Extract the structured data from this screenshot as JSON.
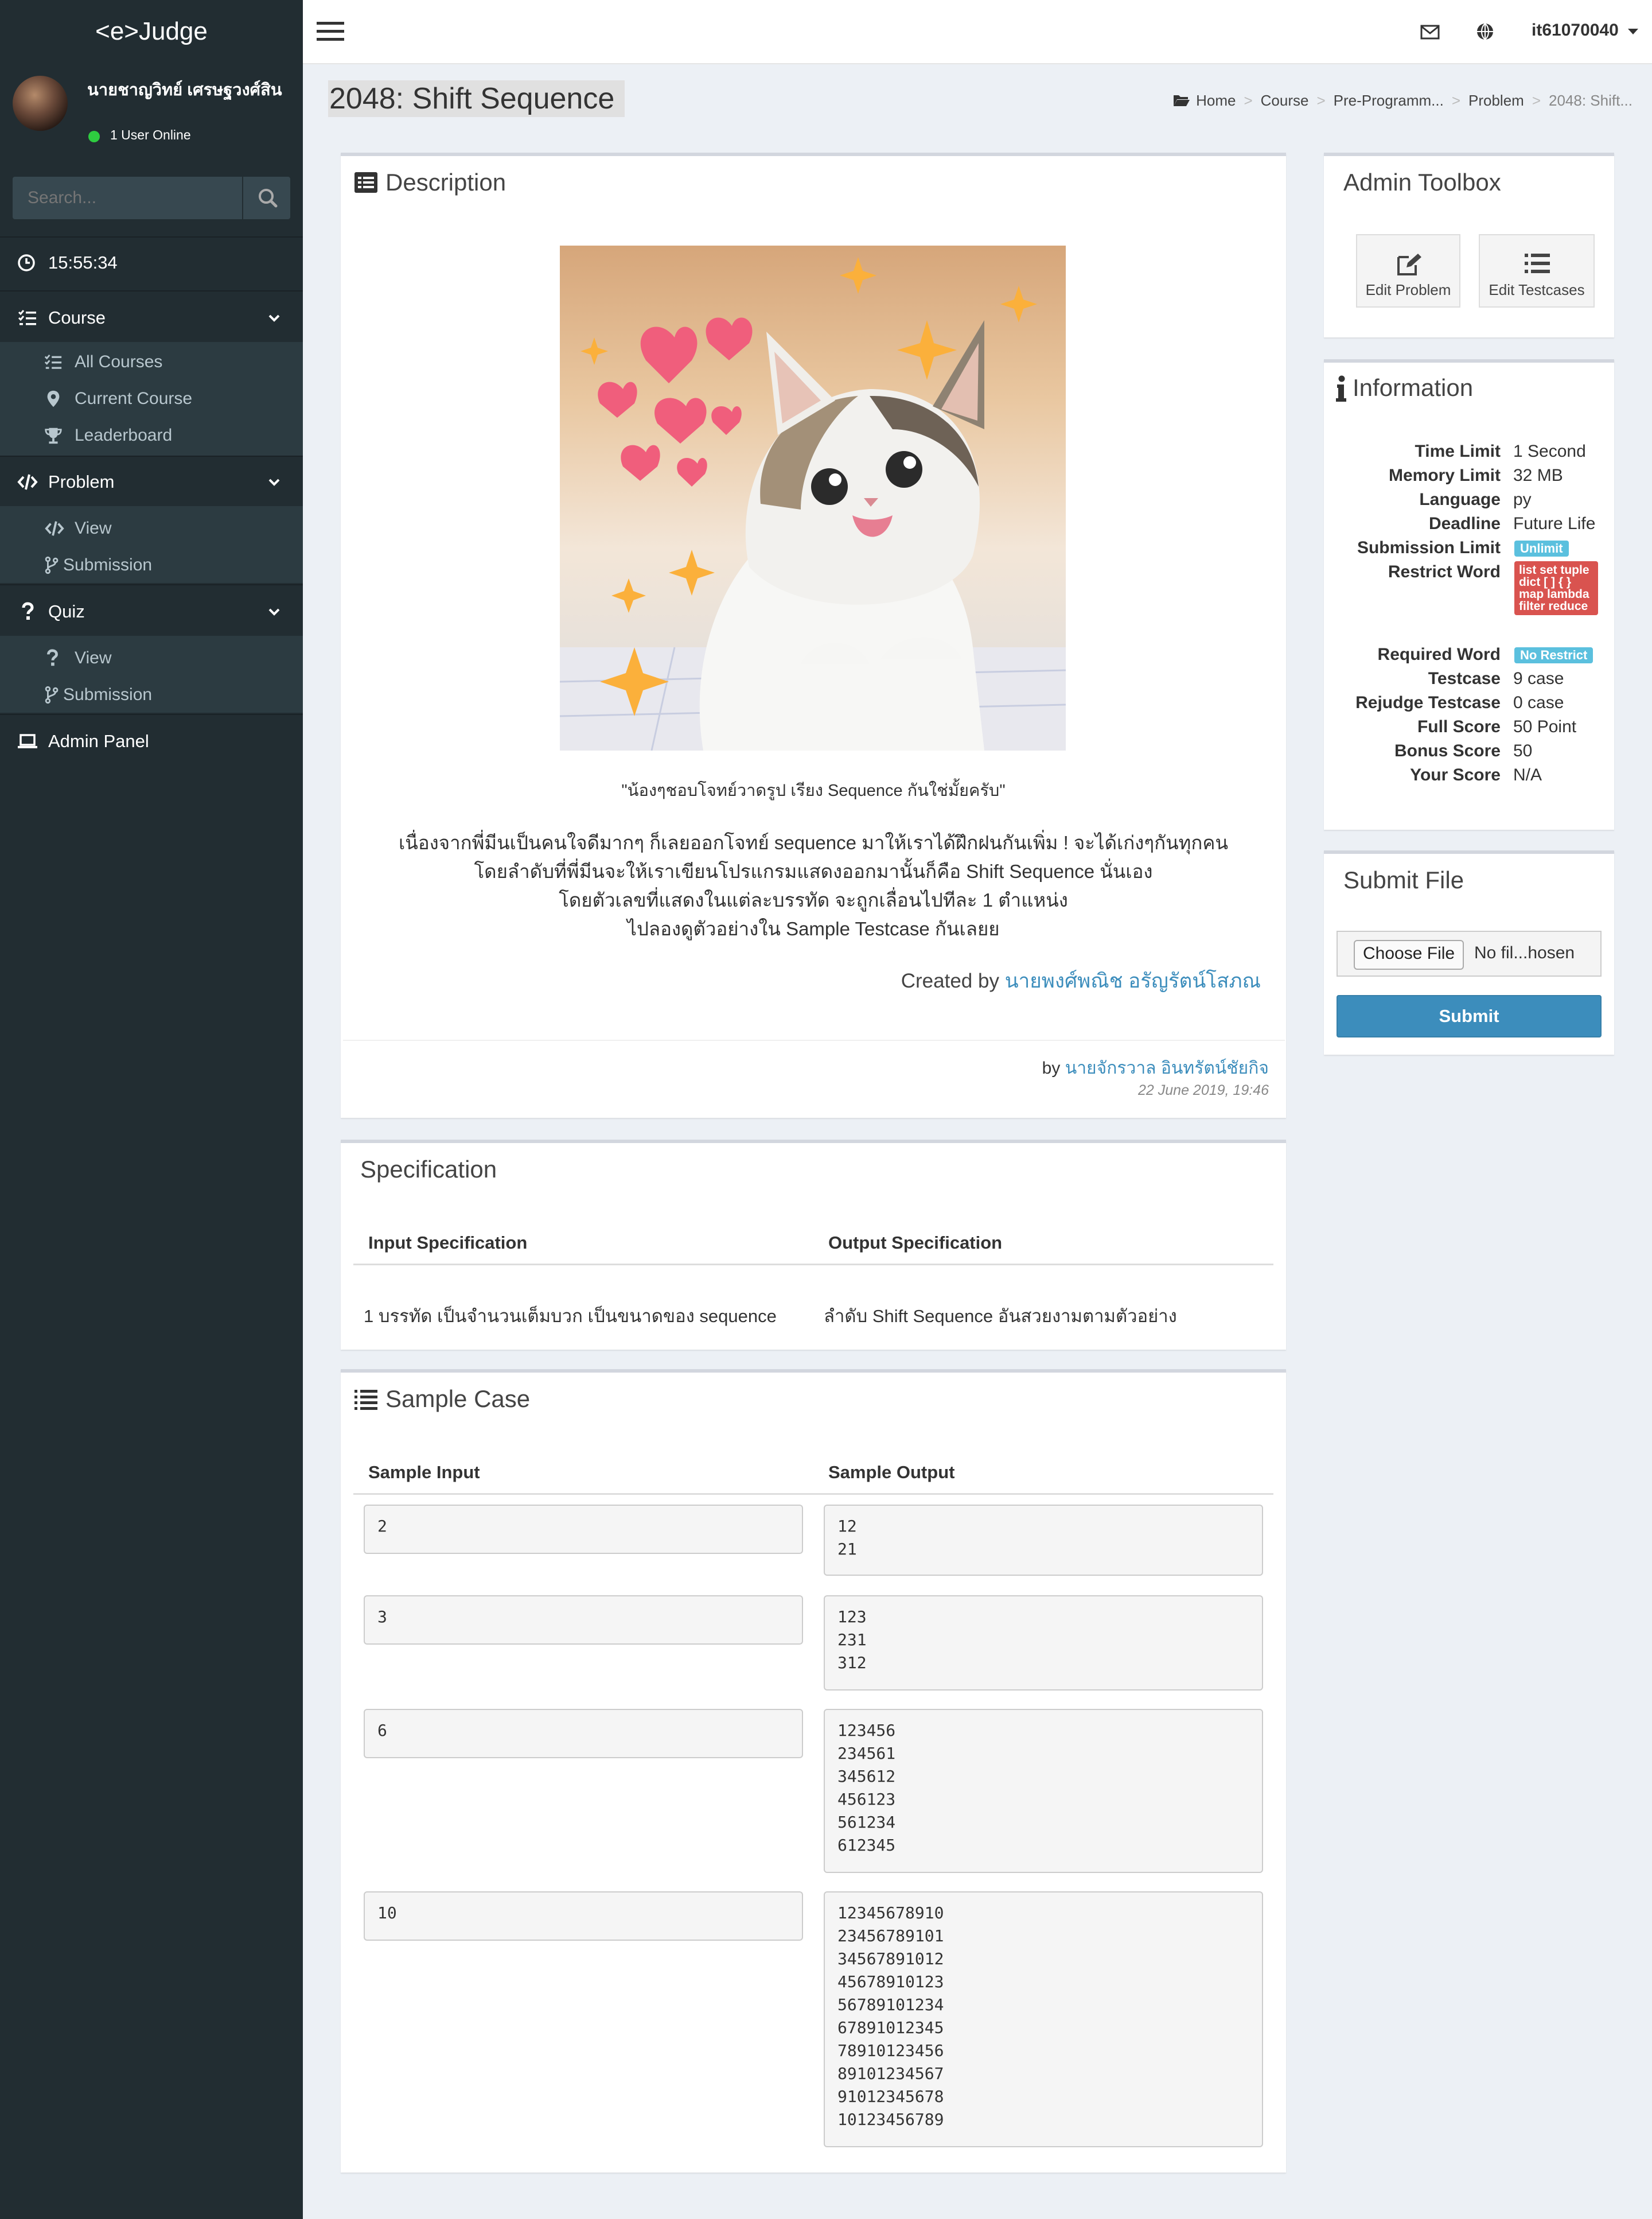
{
  "app": {
    "brand": "<e>Judge"
  },
  "user_panel": {
    "name": "นายชาญวิทย์ เศรษฐวงศ์สิน",
    "status": "1 User Online"
  },
  "search": {
    "placeholder": "Search..."
  },
  "sidebar": {
    "clock": "15:55:34",
    "course": {
      "label": "Course",
      "items": [
        "All Courses",
        "Current Course",
        "Leaderboard"
      ]
    },
    "problem": {
      "label": "Problem",
      "items": [
        "View",
        "Submission"
      ]
    },
    "quiz": {
      "label": "Quiz",
      "items": [
        "View",
        "Submission"
      ]
    },
    "admin": "Admin Panel"
  },
  "topbar": {
    "user": "it61070040"
  },
  "page": {
    "title": "2048: Shift Sequence"
  },
  "breadcrumb": [
    "Home",
    "Course",
    "Pre-Programm...",
    "Problem",
    "2048: Shift..."
  ],
  "description": {
    "title": "Description",
    "caption": "\"น้องๆชอบโจทย์วาดรูป เรียง Sequence กันใช่มั้ยครับ\"",
    "lines": [
      "เนื่องจากพี่มีนเป็นคนใจดีมากๆ ก็เลยออกโจทย์ sequence มาให้เราได้ฝึกฝนกันเพิ่ม ! จะได้เก่งๆกันทุกคน",
      "โดยลำดับที่พี่มีนจะให้เราเขียนโปรแกรมแสดงออกมานั้นก็คือ Shift Sequence นั่นเอง",
      "โดยตัวเลขที่แสดงในแต่ละบรรทัด จะถูกเลื่อนไปทีละ 1 ตำแหน่ง",
      "ไปลองดูตัวอย่างใน Sample Testcase กันเลยย"
    ],
    "created_by_prefix": "Created by",
    "created_by_name": "นายพงศ์พณิช อรัญรัตน์โสภณ",
    "author_prefix": "by",
    "author_name": "นายจักรวาล อินทรัตน์ชัยกิจ",
    "date": "22 June 2019, 19:46"
  },
  "specification": {
    "title": "Specification",
    "input_header": "Input Specification",
    "output_header": "Output Specification",
    "input": "1 บรรทัด เป็นจำนวนเต็มบวก เป็นขนาดของ sequence",
    "output": "ลำดับ Shift Sequence อันสวยงามตามตัวอย่าง"
  },
  "sample": {
    "title": "Sample Case",
    "input_header": "Sample Input",
    "output_header": "Sample Output",
    "cases": [
      {
        "input": "2",
        "output": "12\n21"
      },
      {
        "input": "3",
        "output": "123\n231\n312"
      },
      {
        "input": "6",
        "output": "123456\n234561\n345612\n456123\n561234\n612345"
      },
      {
        "input": "10",
        "output": "12345678910\n23456789101\n34567891012\n45678910123\n56789101234\n67891012345\n78910123456\n89101234567\n91012345678\n10123456789"
      }
    ]
  },
  "admin_toolbox": {
    "title": "Admin Toolbox",
    "edit_problem": "Edit Problem",
    "edit_testcases": "Edit Testcases"
  },
  "information": {
    "title": "Information",
    "time_limit_label": "Time Limit",
    "time_limit": "1 Second",
    "memory_limit_label": "Memory Limit",
    "memory_limit": "32 MB",
    "language_label": "Language",
    "language": "py",
    "deadline_label": "Deadline",
    "deadline": "Future Life",
    "submission_limit_label": "Submission Limit",
    "submission_limit": "Unlimit",
    "restrict_word_label": "Restrict Word",
    "restrict_word": "list set tuple dict [ ] { } map lambda filter reduce",
    "required_word_label": "Required Word",
    "required_word": "No Restrict",
    "testcase_label": "Testcase",
    "testcase": "9 case",
    "rejudge_label": "Rejudge Testcase",
    "rejudge": "0 case",
    "full_score_label": "Full Score",
    "full_score": "50 Point",
    "bonus_score_label": "Bonus Score",
    "bonus_score": "50",
    "your_score_label": "Your Score",
    "your_score": "N/A"
  },
  "submit_file": {
    "title": "Submit File",
    "choose_label": "Choose File",
    "file_status": "No fil...hosen",
    "submit_label": "Submit"
  },
  "colors": {
    "sidebar": "#222d32",
    "accent": "#3c8dbc",
    "badge_info": "#5bc0de",
    "badge_danger": "#d9534f"
  }
}
